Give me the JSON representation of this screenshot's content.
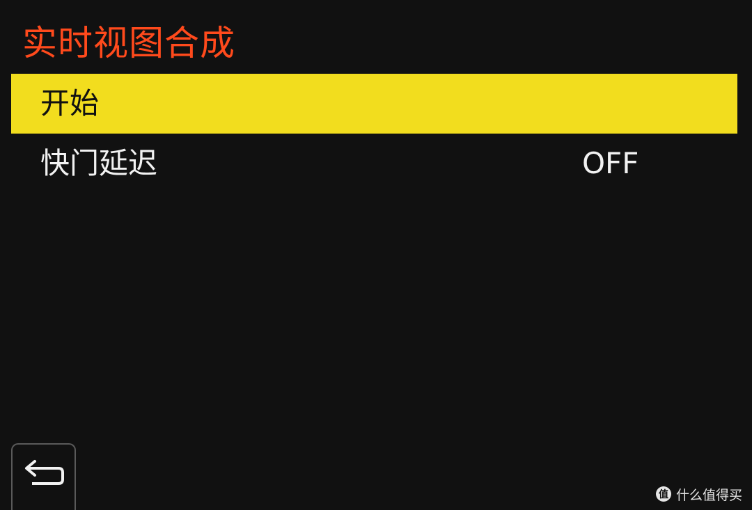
{
  "menu": {
    "title": "实时视图合成",
    "items": [
      {
        "label": "开始",
        "value": ""
      },
      {
        "label": "快门延迟",
        "value": "OFF"
      }
    ]
  },
  "watermark": {
    "text": "什么值得买"
  },
  "icons": {
    "back": "return-arrow-icon",
    "watermark": "smzdm-logo-icon"
  },
  "colors": {
    "background": "#111111",
    "title": "#ff4a1c",
    "selected_bg": "#f2dd1e",
    "text": "#f2f2f2"
  }
}
